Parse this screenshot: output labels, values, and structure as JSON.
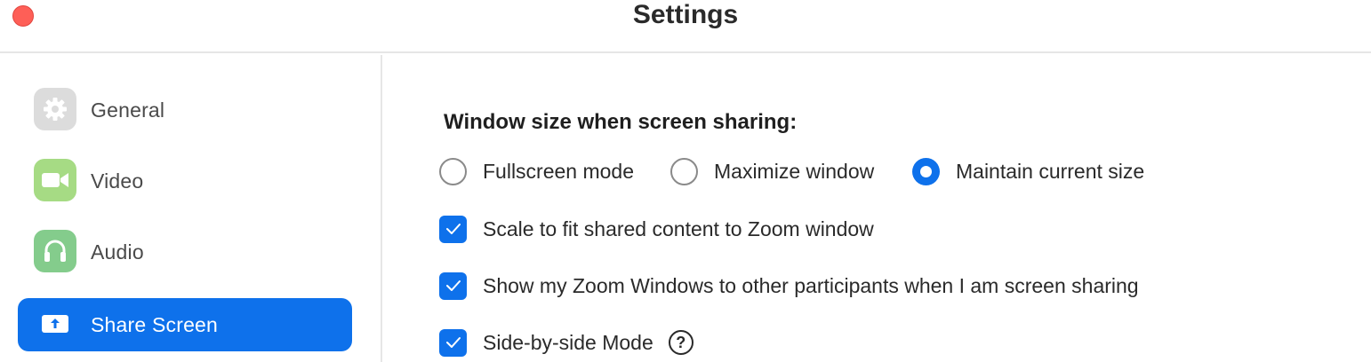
{
  "window": {
    "title": "Settings"
  },
  "sidebar": {
    "items": [
      {
        "label": "General",
        "icon": "gear-icon",
        "active": false
      },
      {
        "label": "Video",
        "icon": "camera-icon",
        "active": false
      },
      {
        "label": "Audio",
        "icon": "headphones-icon",
        "active": false
      },
      {
        "label": "Share Screen",
        "icon": "share-screen-icon",
        "active": true
      }
    ]
  },
  "share_screen": {
    "window_size_heading": "Window size when screen sharing:",
    "window_size_options": [
      {
        "label": "Fullscreen mode",
        "selected": false
      },
      {
        "label": "Maximize window",
        "selected": false
      },
      {
        "label": "Maintain current size",
        "selected": true
      }
    ],
    "checkboxes": [
      {
        "label": "Scale to fit shared content to Zoom window",
        "checked": true
      },
      {
        "label": "Show my Zoom Windows to other participants when I am screen sharing",
        "checked": true
      },
      {
        "label": "Side-by-side Mode",
        "checked": true,
        "help_icon": "?"
      }
    ]
  },
  "colors": {
    "accent": "#0e71eb",
    "close_button": "#fe5f57"
  }
}
